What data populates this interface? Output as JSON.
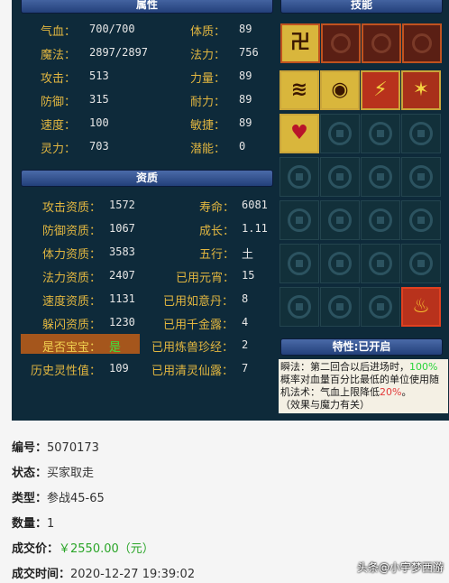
{
  "headers": {
    "attributes": "属性",
    "skills": "技能",
    "qualities": "资质",
    "traits": "特性:已开启"
  },
  "attributes": [
    {
      "label": "气血：",
      "value": "700/700"
    },
    {
      "label": "魔法：",
      "value": "2897/2897"
    },
    {
      "label": "攻击：",
      "value": "513"
    },
    {
      "label": "防御：",
      "value": "315"
    },
    {
      "label": "速度：",
      "value": "100"
    },
    {
      "label": "灵力：",
      "value": "703"
    }
  ],
  "attributes_right": [
    {
      "label": "体质：",
      "value": "89"
    },
    {
      "label": "法力：",
      "value": "756"
    },
    {
      "label": "力量：",
      "value": "89"
    },
    {
      "label": "耐力：",
      "value": "89"
    },
    {
      "label": "敏捷：",
      "value": "89"
    },
    {
      "label": "潜能：",
      "value": "0"
    }
  ],
  "qualities": [
    {
      "label": "攻击资质：",
      "value": "1572"
    },
    {
      "label": "防御资质：",
      "value": "1067"
    },
    {
      "label": "体力资质：",
      "value": "3583"
    },
    {
      "label": "法力资质：",
      "value": "2407"
    },
    {
      "label": "速度资质：",
      "value": "1131"
    },
    {
      "label": "躲闪资质：",
      "value": "1230"
    },
    {
      "label": "是否宝宝：",
      "value": "是"
    },
    {
      "label": "历史灵性值：",
      "value": "109"
    }
  ],
  "qualities_right": [
    {
      "label": "寿命：",
      "value": "6081"
    },
    {
      "label": "成长：",
      "value": "1.11"
    },
    {
      "label": "五行：",
      "value": "土"
    },
    {
      "label": "已用元宵：",
      "value": "15"
    },
    {
      "label": "已用如意丹：",
      "value": "8"
    },
    {
      "label": "已用千金露：",
      "value": "4"
    },
    {
      "label": "已用炼兽珍经：",
      "value": "2"
    },
    {
      "label": "已用清灵仙露：",
      "value": "7"
    }
  ],
  "skills": {
    "top": [
      "rune-icon"
    ],
    "grid_icons": [
      "wind-icon",
      "owl-icon",
      "lightning-icon",
      "spear-burst-icon",
      "heart-icon",
      "fire-icon"
    ]
  },
  "trait_text": {
    "name": "瞬法：",
    "line1": "第二回合以后进场时，",
    "pct1": "100%",
    "line2": "概率对血量百分比最低的单位使用随机法术：气血上限降低",
    "pct2": "20%",
    "line2_end": "。",
    "line3": "（效果与魔力有关）"
  },
  "info": [
    {
      "key": "编号：",
      "value": "5070173"
    },
    {
      "key": "状态：",
      "value": "买家取走"
    },
    {
      "key": "类型：",
      "value": "参战45-65"
    },
    {
      "key": "数量：",
      "value": "1"
    },
    {
      "key": "成交价：",
      "value": "￥2550.00（元）"
    },
    {
      "key": "成交时间：",
      "value": "2020-12-27 19:39:02"
    }
  ],
  "watermark": "头条@小宇梦西游",
  "colors": {
    "panel": "#0e2a3a",
    "label": "#e1b640",
    "price": "#2aa528",
    "trait_green": "#2ad43a",
    "trait_red": "#e33a3a"
  }
}
